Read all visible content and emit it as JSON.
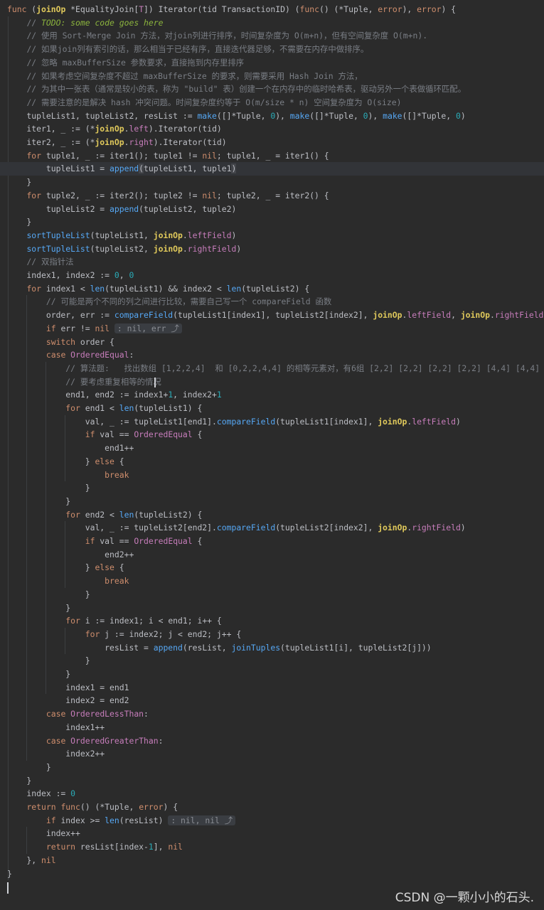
{
  "editor": {
    "language": "Go",
    "theme": {
      "background": "#2b2b2b",
      "keyword": "#cf8e6d",
      "function": "#56a8f5",
      "type": "#c77dbb",
      "number": "#2aacb8",
      "comment": "#7a7e85",
      "todo": "#8bb33d",
      "param": "#e0c95b"
    },
    "lines": [
      [
        [
          "kw",
          "func"
        ],
        [
          "t",
          " ("
        ],
        [
          "prm",
          "joinOp"
        ],
        [
          "t",
          " *"
        ],
        [
          "t",
          "EqualityJoin["
        ],
        [
          "ty",
          "T"
        ],
        [
          "t",
          "]) "
        ],
        [
          "t",
          "Iterator"
        ],
        [
          "t",
          "(tid "
        ],
        [
          "t",
          "TransactionID"
        ],
        [
          "t",
          ") ("
        ],
        [
          "kw",
          "func"
        ],
        [
          "t",
          "() (*"
        ],
        [
          "t",
          "Tuple"
        ],
        [
          "t",
          ", "
        ],
        [
          "kw",
          "error"
        ],
        [
          "t",
          "), "
        ],
        [
          "kw",
          "error"
        ],
        [
          "t",
          ") {"
        ]
      ],
      [
        [
          "t",
          "    "
        ],
        [
          "cm",
          "// "
        ],
        [
          "todo",
          "TODO: some code goes here"
        ]
      ],
      [
        [
          "t",
          "    "
        ],
        [
          "cm",
          "// 使用 Sort-Merge Join 方法，对join列进行排序，时间复杂度为 O(m+n)，但有空间复杂度 O(m+n)."
        ]
      ],
      [
        [
          "t",
          "    "
        ],
        [
          "cm",
          "// 如果join列有索引的话，那么相当于已经有序，直接迭代器足够，不需要在内存中做排序。"
        ]
      ],
      [
        [
          "t",
          "    "
        ],
        [
          "cm",
          "// 忽略 maxBufferSize 参数要求，直接拖到内存里排序"
        ]
      ],
      [
        [
          "t",
          "    "
        ],
        [
          "cm",
          "// 如果考虑空间复杂度不超过 maxBufferSize 的要求，则需要采用 Hash Join 方法，"
        ]
      ],
      [
        [
          "t",
          "    "
        ],
        [
          "cm",
          "// 为其中一张表（通常是较小的表，称为 \"build\" 表）创建一个在内存中的临时哈希表，驱动另外一个表做循环匹配。"
        ]
      ],
      [
        [
          "t",
          "    "
        ],
        [
          "cm",
          "// 需要注意的是解决 hash 冲突问题。时间复杂度约等于 O(m/size * n) 空间复杂度为 O(size)"
        ]
      ],
      [
        [
          "t",
          "    tupleList1, tupleList2, resList := "
        ],
        [
          "fn",
          "make"
        ],
        [
          "t",
          "([]*"
        ],
        [
          "t",
          "Tuple"
        ],
        [
          "t",
          ", "
        ],
        [
          "num",
          "0"
        ],
        [
          "t",
          "), "
        ],
        [
          "fn",
          "make"
        ],
        [
          "t",
          "([]*"
        ],
        [
          "t",
          "Tuple"
        ],
        [
          "t",
          ", "
        ],
        [
          "num",
          "0"
        ],
        [
          "t",
          "), "
        ],
        [
          "fn",
          "make"
        ],
        [
          "t",
          "([]*"
        ],
        [
          "t",
          "Tuple"
        ],
        [
          "t",
          ", "
        ],
        [
          "num",
          "0"
        ],
        [
          "t",
          ")"
        ]
      ],
      [
        [
          "t",
          "    iter1, _ := (*"
        ],
        [
          "prm",
          "joinOp"
        ],
        [
          "t",
          "."
        ],
        [
          "fld",
          "left"
        ],
        [
          "t",
          ")."
        ],
        [
          "t",
          "Iterator"
        ],
        [
          "t",
          "(tid)"
        ]
      ],
      [
        [
          "t",
          "    iter2, _ := (*"
        ],
        [
          "prm",
          "joinOp"
        ],
        [
          "t",
          "."
        ],
        [
          "fld",
          "right"
        ],
        [
          "t",
          ")."
        ],
        [
          "t",
          "Iterator"
        ],
        [
          "t",
          "(tid)"
        ]
      ],
      [
        [
          "t",
          "    "
        ],
        [
          "kw",
          "for"
        ],
        [
          "t",
          " tuple1, _ := iter1(); tuple1 != "
        ],
        [
          "kw",
          "nil"
        ],
        [
          "t",
          "; tuple1, _ = iter1() {"
        ]
      ],
      [
        [
          "t",
          "        tupleList1 = "
        ],
        [
          "fn",
          "append"
        ],
        [
          "mb",
          "("
        ],
        [
          "t",
          "tupleList1, tuple1"
        ],
        [
          "mb",
          ")"
        ]
      ],
      [
        [
          "t",
          "    }"
        ]
      ],
      [
        [
          "t",
          "    "
        ],
        [
          "kw",
          "for"
        ],
        [
          "t",
          " tuple2, _ := iter2(); tuple2 != "
        ],
        [
          "kw",
          "nil"
        ],
        [
          "t",
          "; tuple2, _ = iter2() {"
        ]
      ],
      [
        [
          "t",
          "        tupleList2 = "
        ],
        [
          "fn",
          "append"
        ],
        [
          "t",
          "(tupleList2, tuple2)"
        ]
      ],
      [
        [
          "t",
          "    }"
        ]
      ],
      [
        [
          "t",
          "    "
        ],
        [
          "fn",
          "sortTupleList"
        ],
        [
          "t",
          "(tupleList1, "
        ],
        [
          "prm",
          "joinOp"
        ],
        [
          "t",
          "."
        ],
        [
          "fld",
          "leftField"
        ],
        [
          "t",
          ")"
        ]
      ],
      [
        [
          "t",
          "    "
        ],
        [
          "fn",
          "sortTupleList"
        ],
        [
          "t",
          "(tupleList2, "
        ],
        [
          "prm",
          "joinOp"
        ],
        [
          "t",
          "."
        ],
        [
          "fld",
          "rightField"
        ],
        [
          "t",
          ")"
        ]
      ],
      [
        [
          "t",
          "    "
        ],
        [
          "cm",
          "// 双指针法"
        ]
      ],
      [
        [
          "t",
          "    index1, index2 := "
        ],
        [
          "num",
          "0"
        ],
        [
          "t",
          ", "
        ],
        [
          "num",
          "0"
        ]
      ],
      [
        [
          "t",
          "    "
        ],
        [
          "kw",
          "for"
        ],
        [
          "t",
          " index1 < "
        ],
        [
          "fn",
          "len"
        ],
        [
          "t",
          "(tupleList1) && index2 < "
        ],
        [
          "fn",
          "len"
        ],
        [
          "t",
          "(tupleList2) {"
        ]
      ],
      [
        [
          "t",
          "        "
        ],
        [
          "cm",
          "// 可能是两个不同的列之间进行比较，需要自己写一个 compareField 函数"
        ]
      ],
      [
        [
          "t",
          "        order, err := "
        ],
        [
          "fn",
          "compareField"
        ],
        [
          "t",
          "(tupleList1[index1], tupleList2[index2], "
        ],
        [
          "prm",
          "joinOp"
        ],
        [
          "t",
          "."
        ],
        [
          "fld",
          "leftField"
        ],
        [
          "t",
          ", "
        ],
        [
          "prm",
          "joinOp"
        ],
        [
          "t",
          "."
        ],
        [
          "fld",
          "rightField"
        ],
        [
          "t",
          ")"
        ]
      ],
      [
        [
          "t",
          "        "
        ],
        [
          "kw",
          "if"
        ],
        [
          "t",
          " err != "
        ],
        [
          "kw",
          "nil"
        ],
        [
          "t",
          " "
        ],
        [
          "hint",
          ": nil, err ⤴"
        ]
      ],
      [
        [
          "t",
          "        "
        ],
        [
          "kw",
          "switch"
        ],
        [
          "t",
          " order {"
        ]
      ],
      [
        [
          "t",
          "        "
        ],
        [
          "kw",
          "case"
        ],
        [
          "t",
          " "
        ],
        [
          "ty",
          "OrderedEqual"
        ],
        [
          "t",
          ":"
        ]
      ],
      [
        [
          "t",
          "            "
        ],
        [
          "cm",
          "// 算法题:   找出数组 [1,2,2,4]  和 [0,2,2,4,4] 的相等元素对，有6组 [2,2] [2,2] [2,2] [2,2] [4,4] [4,4]"
        ]
      ],
      [
        [
          "t",
          "            "
        ],
        [
          "cm",
          "// 要考虑重复相等的情况"
        ]
      ],
      [
        [
          "t",
          "            end1, end2 := index1+"
        ],
        [
          "num",
          "1"
        ],
        [
          "t",
          ", index2+"
        ],
        [
          "num",
          "1"
        ]
      ],
      [
        [
          "t",
          "            "
        ],
        [
          "kw",
          "for"
        ],
        [
          "t",
          " end1 < "
        ],
        [
          "fn",
          "len"
        ],
        [
          "t",
          "(tupleList1) {"
        ]
      ],
      [
        [
          "t",
          "                val, _ := tupleList1[end1]."
        ],
        [
          "fn",
          "compareField"
        ],
        [
          "t",
          "(tupleList1[index1], "
        ],
        [
          "prm",
          "joinOp"
        ],
        [
          "t",
          "."
        ],
        [
          "fld",
          "leftField"
        ],
        [
          "t",
          ")"
        ]
      ],
      [
        [
          "t",
          "                "
        ],
        [
          "kw",
          "if"
        ],
        [
          "t",
          " val == "
        ],
        [
          "ty",
          "OrderedEqual"
        ],
        [
          "t",
          " {"
        ]
      ],
      [
        [
          "t",
          "                    end1++"
        ]
      ],
      [
        [
          "t",
          "                } "
        ],
        [
          "kw",
          "else"
        ],
        [
          "t",
          " {"
        ]
      ],
      [
        [
          "t",
          "                    "
        ],
        [
          "kw",
          "break"
        ]
      ],
      [
        [
          "t",
          "                }"
        ]
      ],
      [
        [
          "t",
          "            }"
        ]
      ],
      [
        [
          "t",
          "            "
        ],
        [
          "kw",
          "for"
        ],
        [
          "t",
          " end2 < "
        ],
        [
          "fn",
          "len"
        ],
        [
          "t",
          "(tupleList2) {"
        ]
      ],
      [
        [
          "t",
          "                val, _ := tupleList2[end2]."
        ],
        [
          "fn",
          "compareField"
        ],
        [
          "t",
          "(tupleList2[index2], "
        ],
        [
          "prm",
          "joinOp"
        ],
        [
          "t",
          "."
        ],
        [
          "fld",
          "rightField"
        ],
        [
          "t",
          ")"
        ]
      ],
      [
        [
          "t",
          "                "
        ],
        [
          "kw",
          "if"
        ],
        [
          "t",
          " val == "
        ],
        [
          "ty",
          "OrderedEqual"
        ],
        [
          "t",
          " {"
        ]
      ],
      [
        [
          "t",
          "                    end2++"
        ]
      ],
      [
        [
          "t",
          "                } "
        ],
        [
          "kw",
          "else"
        ],
        [
          "t",
          " {"
        ]
      ],
      [
        [
          "t",
          "                    "
        ],
        [
          "kw",
          "break"
        ]
      ],
      [
        [
          "t",
          "                }"
        ]
      ],
      [
        [
          "t",
          "            }"
        ]
      ],
      [
        [
          "t",
          "            "
        ],
        [
          "kw",
          "for"
        ],
        [
          "t",
          " i := index1; i < end1; i++ {"
        ]
      ],
      [
        [
          "t",
          "                "
        ],
        [
          "kw",
          "for"
        ],
        [
          "t",
          " j := index2; j < end2; j++ {"
        ]
      ],
      [
        [
          "t",
          "                    resList = "
        ],
        [
          "fn",
          "append"
        ],
        [
          "t",
          "(resList, "
        ],
        [
          "fn",
          "joinTuples"
        ],
        [
          "t",
          "(tupleList1[i], tupleList2[j]))"
        ]
      ],
      [
        [
          "t",
          "                }"
        ]
      ],
      [
        [
          "t",
          "            }"
        ]
      ],
      [
        [
          "t",
          "            index1 = end1"
        ]
      ],
      [
        [
          "t",
          "            index2 = end2"
        ]
      ],
      [
        [
          "t",
          "        "
        ],
        [
          "kw",
          "case"
        ],
        [
          "t",
          " "
        ],
        [
          "ty",
          "OrderedLessThan"
        ],
        [
          "t",
          ":"
        ]
      ],
      [
        [
          "t",
          "            index1++"
        ]
      ],
      [
        [
          "t",
          "        "
        ],
        [
          "kw",
          "case"
        ],
        [
          "t",
          " "
        ],
        [
          "ty",
          "OrderedGreaterThan"
        ],
        [
          "t",
          ":"
        ]
      ],
      [
        [
          "t",
          "            index2++"
        ]
      ],
      [
        [
          "t",
          "        }"
        ]
      ],
      [
        [
          "t",
          "    }"
        ]
      ],
      [
        [
          "t",
          "    index := "
        ],
        [
          "num",
          "0"
        ]
      ],
      [
        [
          "t",
          "    "
        ],
        [
          "kw",
          "return"
        ],
        [
          "t",
          " "
        ],
        [
          "kw",
          "func"
        ],
        [
          "t",
          "() (*"
        ],
        [
          "t",
          "Tuple"
        ],
        [
          "t",
          ", "
        ],
        [
          "kw",
          "error"
        ],
        [
          "t",
          ") {"
        ]
      ],
      [
        [
          "t",
          "        "
        ],
        [
          "kw",
          "if"
        ],
        [
          "t",
          " index >= "
        ],
        [
          "fn",
          "len"
        ],
        [
          "t",
          "(resList) "
        ],
        [
          "hint",
          ": nil, nil ⤴"
        ]
      ],
      [
        [
          "t",
          "        index++"
        ]
      ],
      [
        [
          "t",
          "        "
        ],
        [
          "kw",
          "return"
        ],
        [
          "t",
          " resList[index-"
        ],
        [
          "num",
          "1"
        ],
        [
          "t",
          "], "
        ],
        [
          "kw",
          "nil"
        ]
      ],
      [
        [
          "t",
          "    }, "
        ],
        [
          "kw",
          "nil"
        ]
      ],
      [
        [
          "t",
          "}"
        ]
      ],
      [
        [
          "t",
          ""
        ]
      ]
    ],
    "highlighted_lines": [
      12,
      67
    ]
  },
  "watermark": "CSDN @一颗小小的石头."
}
